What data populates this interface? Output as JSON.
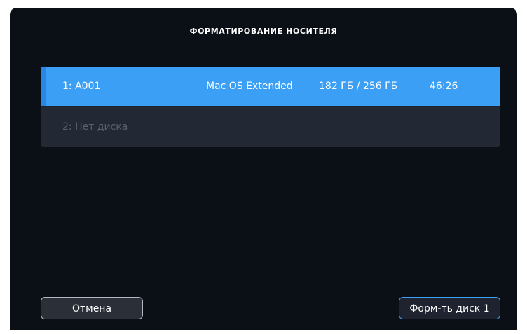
{
  "dialog": {
    "title": "ФОРМАТИРОВАНИЕ НОСИТЕЛЯ"
  },
  "media": [
    {
      "name": "1: A001",
      "format": "Mac OS Extended",
      "capacity": "182 ГБ / 256 ГБ",
      "time": "46:26",
      "selected": true
    },
    {
      "name": "2: Нет диска",
      "format": "",
      "capacity": "",
      "time": "",
      "selected": false
    }
  ],
  "buttons": {
    "cancel_label": "Отмена",
    "format_label": "Форм-ть диск 1"
  },
  "colors": {
    "selected_row": "#3a9ff5",
    "background": "#0b0f16",
    "accent": "#2a86e6"
  }
}
